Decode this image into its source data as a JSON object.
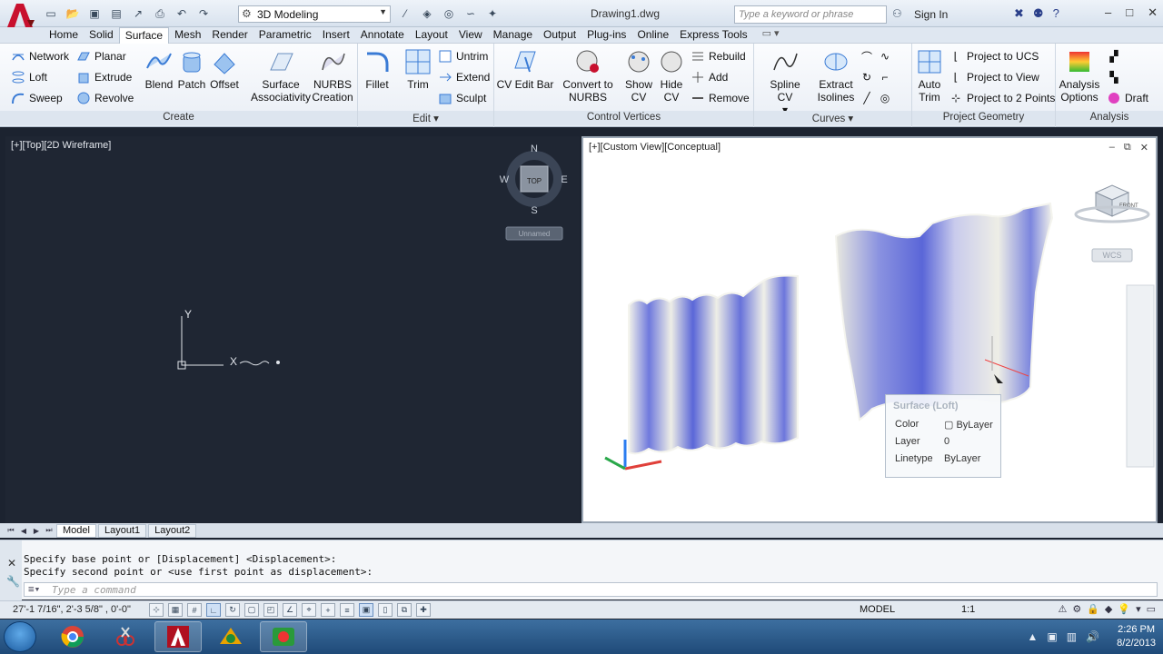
{
  "title_bar": {
    "workspace": "3D Modeling",
    "document_title": "Drawing1.dwg",
    "search_placeholder": "Type a keyword or phrase",
    "sign_in": "Sign In"
  },
  "ribbon_tabs": [
    "Home",
    "Solid",
    "Surface",
    "Mesh",
    "Render",
    "Parametric",
    "Insert",
    "Annotate",
    "Layout",
    "View",
    "Manage",
    "Output",
    "Plug-ins",
    "Online",
    "Express Tools"
  ],
  "active_tab": "Surface",
  "ribbon": {
    "create": {
      "title": "Create",
      "network": "Network",
      "loft": "Loft",
      "sweep": "Sweep",
      "planar": "Planar",
      "extrude": "Extrude",
      "revolve": "Revolve",
      "blend": "Blend",
      "patch": "Patch",
      "offset": "Offset",
      "surface_assoc_1": "Surface",
      "surface_assoc_2": "Associativity",
      "nurbs_1": "NURBS",
      "nurbs_2": "Creation"
    },
    "edit": {
      "title": "Edit",
      "fillet": "Fillet",
      "trim": "Trim",
      "untrim": "Untrim",
      "extend": "Extend",
      "sculpt": "Sculpt"
    },
    "control_vertices": {
      "title": "Control Vertices",
      "cv_edit_bar": "CV Edit Bar",
      "convert_1": "Convert to",
      "convert_2": "NURBS",
      "show_cv_1": "Show",
      "show_cv_2": "CV",
      "hide_cv_1": "Hide",
      "hide_cv_2": "CV",
      "rebuild": "Rebuild",
      "add": "Add",
      "remove": "Remove"
    },
    "curves": {
      "title": "Curves",
      "spline_cv": "Spline CV",
      "extract_1": "Extract",
      "extract_2": "Isolines"
    },
    "project_geometry": {
      "title": "Project Geometry",
      "auto_trim_1": "Auto",
      "auto_trim_2": "Trim",
      "project_ucs": "Project to UCS",
      "project_view": "Project to View",
      "project_2pts": "Project to 2 Points"
    },
    "analysis": {
      "title": "Analysis",
      "analysis_options_1": "Analysis",
      "analysis_options_2": "Options",
      "draft": "Draft"
    }
  },
  "viewports": {
    "left_label": "[+][Top][2D Wireframe]",
    "right_label": "[+][Custom View][Conceptual]",
    "compass": {
      "n": "N",
      "s": "S",
      "e": "E",
      "w": "W",
      "top": "TOP"
    },
    "unnamed": "Unnamed",
    "ucs_y": "Y",
    "ucs_x": "X",
    "wcs": "WCS",
    "viewcube_face": "FRONT"
  },
  "tooltip": {
    "title": "Surface (Loft)",
    "color_label": "Color",
    "color_value": "ByLayer",
    "layer_label": "Layer",
    "layer_value": "0",
    "linetype_label": "Linetype",
    "linetype_value": "ByLayer"
  },
  "layout_tabs": [
    "Model",
    "Layout1",
    "Layout2"
  ],
  "command": {
    "history_1": "Specify base point or [Displacement] <Displacement>:",
    "history_2": "Specify second point or <use first point as displacement>:",
    "placeholder": "Type a command"
  },
  "status_bar": {
    "coords": "27'-1 7/16\", 2'-3 5/8\" , 0'-0\"",
    "model": "MODEL",
    "scale": "1:1"
  },
  "taskbar": {
    "time": "2:26 PM",
    "date": "8/2/2013"
  },
  "colors": {
    "surface_blue": "#5a66d8",
    "surface_light": "#f2f2e8",
    "viewport_dark": "#1f2633",
    "autocad_red": "#c8102e"
  }
}
